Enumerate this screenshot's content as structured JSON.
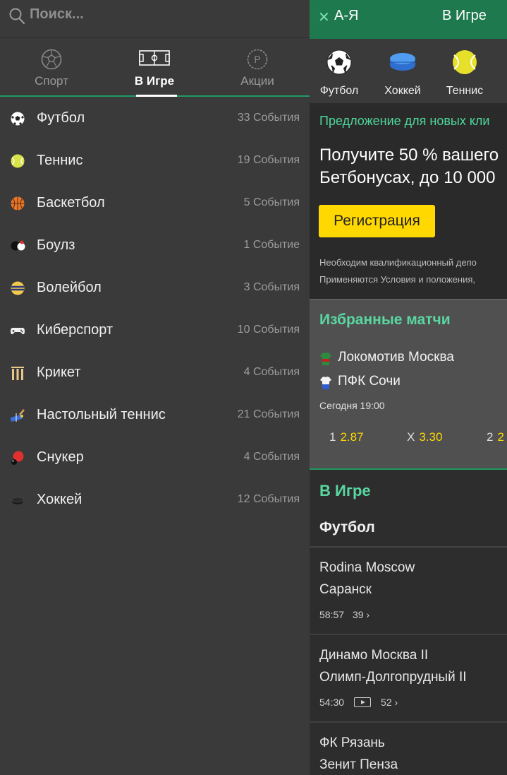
{
  "search": {
    "placeholder": "Поиск..."
  },
  "drawer_tabs": [
    {
      "label": "Спорт",
      "icon": "soccer-ball-outline-icon"
    },
    {
      "label": "В Игре",
      "icon": "pitch-icon",
      "active": true
    },
    {
      "label": "Акции",
      "icon": "promo-p-icon"
    }
  ],
  "sports": [
    {
      "name": "Футбол",
      "count": "33 События",
      "icon": "soccer-ball-icon"
    },
    {
      "name": "Теннис",
      "count": "19 События",
      "icon": "tennis-ball-icon"
    },
    {
      "name": "Баскетбол",
      "count": "5 События",
      "icon": "basketball-icon"
    },
    {
      "name": "Боулз",
      "count": "1 Событие",
      "icon": "bowls-icon"
    },
    {
      "name": "Волейбол",
      "count": "3 События",
      "icon": "volleyball-icon"
    },
    {
      "name": "Киберспорт",
      "count": "10 События",
      "icon": "gamepad-icon"
    },
    {
      "name": "Крикет",
      "count": "4 События",
      "icon": "cricket-stumps-icon"
    },
    {
      "name": "Настольный теннис",
      "count": "21 События",
      "icon": "table-tennis-icon"
    },
    {
      "name": "Снукер",
      "count": "4 События",
      "icon": "snooker-icon"
    },
    {
      "name": "Хоккей",
      "count": "12 События",
      "icon": "hockey-puck-icon"
    }
  ],
  "topbar": {
    "close_icon": "close-icon",
    "az_label": "А-Я",
    "live_label": "В Игре"
  },
  "categories": [
    {
      "label": "Футбол",
      "icon": "soccer-ball-icon"
    },
    {
      "label": "Хоккей",
      "icon": "hockey-puck-icon"
    },
    {
      "label": "Теннис",
      "icon": "tennis-ball-icon"
    }
  ],
  "promo": {
    "headline": "Предложение для новых кли",
    "text_line1": "Получите 50 % вашего",
    "text_line2": "Бетбонусах, до 10 000",
    "button": "Регистрация",
    "note_line1": "Необходим квалификационный депо",
    "note_line2": "Применяются Условия и положения,"
  },
  "featured": {
    "title": "Избранные матчи",
    "home": "Локомотив Москва",
    "away": "ПФК Сочи",
    "time": "Сегодня 19:00",
    "odds": [
      {
        "key": "1",
        "value": "2.87"
      },
      {
        "key": "X",
        "value": "3.30"
      },
      {
        "key": "2",
        "value": "2"
      }
    ]
  },
  "live": {
    "title": "В Игре",
    "sport": "Футбол",
    "matches": [
      {
        "team1": "Rodina Moscow",
        "team2": "Саранск",
        "clock": "58:57",
        "markets": "39 ›",
        "tv": false
      },
      {
        "team1": "Динамо Москва II",
        "team2": "Олимп-Долгопрудный II",
        "clock": "54:30",
        "markets": "52 ›",
        "tv": true
      },
      {
        "team1": "ФК Рязань",
        "team2": "Зенит Пенза",
        "clock": "",
        "markets": "",
        "tv": false
      }
    ]
  }
}
